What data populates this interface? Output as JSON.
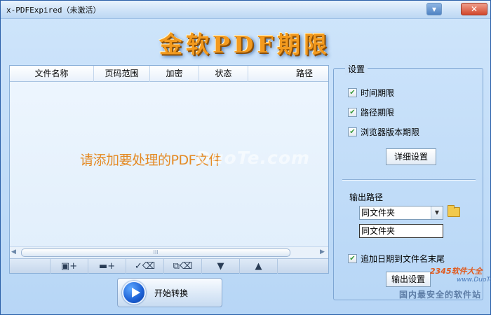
{
  "window": {
    "title": "x-PDFExpired（未激活）"
  },
  "titlebar": {
    "minimize_icon": "minimize-icon",
    "close_icon": "close-icon"
  },
  "banner": {
    "title": "金软PDF期限"
  },
  "file_list": {
    "columns": [
      "文件名称",
      "页码范围",
      "加密",
      "状态",
      "路径"
    ],
    "empty_hint": "请添加要处理的PDF文件",
    "scroll_grip": "III",
    "toolbar": [
      {
        "name": "add-file-button",
        "icon": "add-file-icon",
        "glyph": "▣+"
      },
      {
        "name": "add-folder-button",
        "icon": "add-folder-icon",
        "glyph": "▬+"
      },
      {
        "name": "remove-selected-button",
        "icon": "check-delete-icon",
        "glyph": "✓⌫"
      },
      {
        "name": "remove-all-button",
        "icon": "copy-delete-icon",
        "glyph": "⧉⌫"
      },
      {
        "name": "move-down-button",
        "icon": "arrow-down-icon",
        "glyph": "▼"
      },
      {
        "name": "move-up-button",
        "icon": "arrow-up-icon",
        "glyph": "▲"
      }
    ]
  },
  "start": {
    "label": "开始转换"
  },
  "settings": {
    "title": "设置",
    "time_limit": {
      "label": "时间期限",
      "checked": true
    },
    "path_limit": {
      "label": "路径期限",
      "checked": true
    },
    "browser_limit": {
      "label": "浏览器版本期限",
      "checked": true
    },
    "detail_button": "详细设置",
    "output_label": "输出路径",
    "output_select_value": "同文件夹",
    "output_path_value": "同文件夹",
    "append_date": {
      "label": "追加日期到文件名末尾",
      "checked": true
    },
    "save_button": "输出设置"
  },
  "watermarks": {
    "mid": "DuoTe.com",
    "brand": "2345软件大全",
    "url": "www.DuoTe.com",
    "slogan": "国内最安全的软件站"
  },
  "colors": {
    "accent": "#f39a1e",
    "hint": "#e48a24",
    "window_bg": "#c9e0f8",
    "check": "#3b9a3b"
  }
}
